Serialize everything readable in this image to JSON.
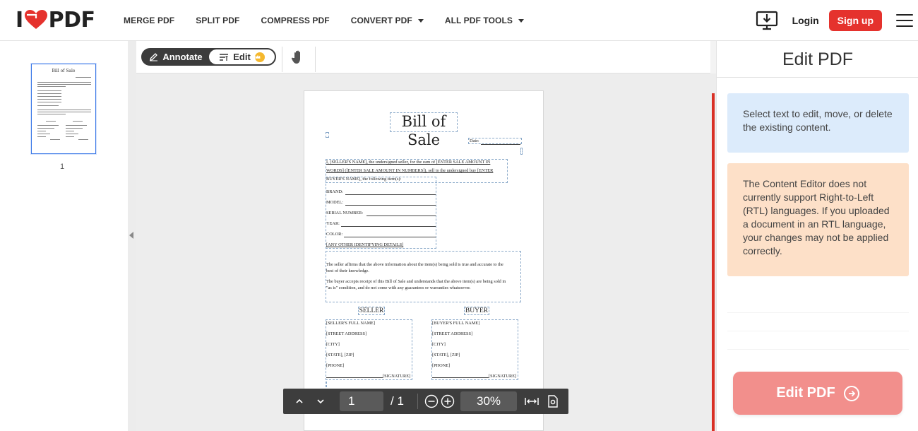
{
  "header": {
    "logo": {
      "prefix": "I",
      "suffix": "PDF",
      "heart_color": "#e5322d"
    },
    "nav": [
      {
        "label": "MERGE PDF",
        "dropdown": false
      },
      {
        "label": "SPLIT PDF",
        "dropdown": false
      },
      {
        "label": "COMPRESS PDF",
        "dropdown": false
      },
      {
        "label": "CONVERT PDF",
        "dropdown": true
      },
      {
        "label": "ALL PDF TOOLS",
        "dropdown": true
      }
    ],
    "login": "Login",
    "signup": "Sign up",
    "accent_color": "#e5322d"
  },
  "sidebar": {
    "thumbnail_title": "Bill of Sale",
    "page_number": "1"
  },
  "toolbar": {
    "annotate_label": "Annotate",
    "edit_label": "Edit"
  },
  "document": {
    "title": "Bill of Sale",
    "date_label": "Date:",
    "para1_a": "I, [SELLER'S NAME], the undersigned seller, for the sum of [ENTER SALE AMOUNT IN",
    "para1_b": "WORDS] ([ENTER SALE AMOUNT IN NUMBERS]), sell to the undersigned buy [ENTER",
    "para1_c": "BUYER'S NAME], the following item(s):",
    "fields": [
      "BRAND:",
      "MODEL:",
      "SERIAL NUMBER:",
      "YEAR:",
      "COLOR:"
    ],
    "other_details": "[ANY OTHER IDENTIFYING DETAILS]",
    "affirm_a": "The seller affirms that the above information about the item(s) being sold is true and accurate to the",
    "affirm_b": "best of their knowledge.",
    "accept_a": "The buyer accepts receipt of this Bill of Sale and understands that the above item(s) are being sold in",
    "accept_b": "\"as is\" condition, and do not come with any guarantees or warranties whatsoever.",
    "seller_heading": "SELLER",
    "buyer_heading": "BUYER",
    "seller_lines": [
      "[SELLER'S FULL NAME]",
      "[STREET ADDRESS]",
      "[CITY]",
      "[STATE], [ZIP]",
      "[PHONE]"
    ],
    "buyer_lines": [
      "[BUYER'S FULL NAME]",
      "[STREET ADDRESS]",
      "[CITY]",
      "[STATE], [ZIP]",
      "[PHONE]"
    ],
    "signature": "[SIGNATURE]"
  },
  "pager": {
    "current_page": "1",
    "total_pages": "/ 1",
    "zoom": "30%"
  },
  "right_panel": {
    "title": "Edit PDF",
    "info_blue": "Select text to edit, move, or delete the existing content.",
    "info_orange": "The Content Editor does not currently support Right-to-Left (RTL) languages. If you uploaded a document in an RTL language, your changes may not be applied correctly.",
    "cta_label": "Edit PDF",
    "cta_color": "#f28f8c"
  }
}
